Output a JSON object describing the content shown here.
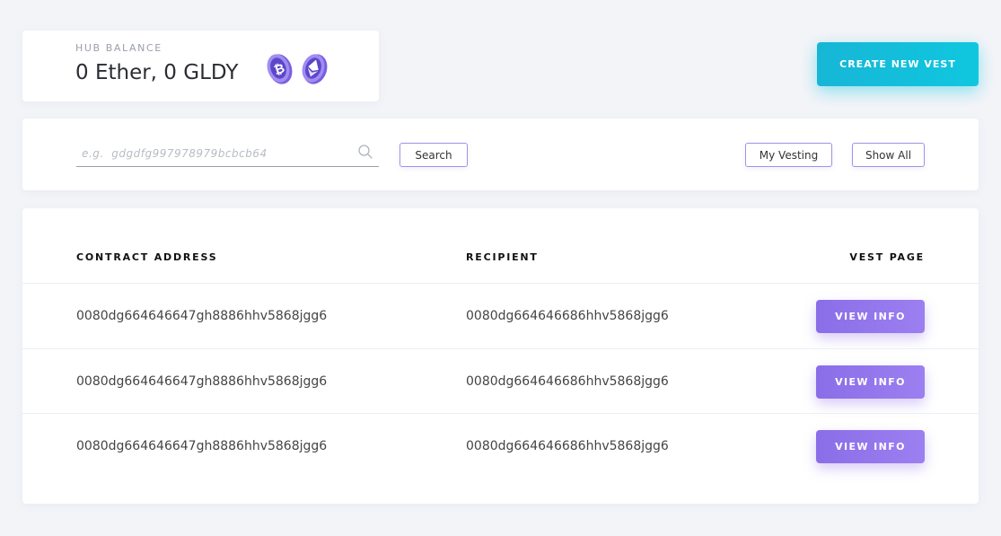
{
  "balance": {
    "label": "HUB BALANCE",
    "value": "0  Ether, 0 GLDY",
    "coins": [
      {
        "icon": "bitcoin-coin-icon"
      },
      {
        "icon": "ethereum-coin-icon"
      }
    ]
  },
  "actions": {
    "create_label": "CREATE NEW VEST"
  },
  "search": {
    "placeholder": "e.g.  gdgdfg997978979bcbcb64",
    "value": "",
    "search_label": "Search",
    "my_vesting_label": "My Vesting",
    "show_all_label": "Show All"
  },
  "table": {
    "headers": {
      "address": "CONTRACT ADDRESS",
      "recipient": "RECIPIENT",
      "vest_page": "VEST PAGE"
    },
    "rows": [
      {
        "address": "0080dg664646647gh8886hhv5868jgg6",
        "recipient": "0080dg664646686hhv5868jgg6",
        "action": "VIEW INFO"
      },
      {
        "address": "0080dg664646647gh8886hhv5868jgg6",
        "recipient": "0080dg664646686hhv5868jgg6",
        "action": "VIEW INFO"
      },
      {
        "address": "0080dg664646647gh8886hhv5868jgg6",
        "recipient": "0080dg664646686hhv5868jgg6",
        "action": "VIEW INFO"
      }
    ]
  },
  "colors": {
    "accent_cyan": "#10c7df",
    "accent_purple": "#8a6ee8",
    "background": "#f3f4f8"
  }
}
